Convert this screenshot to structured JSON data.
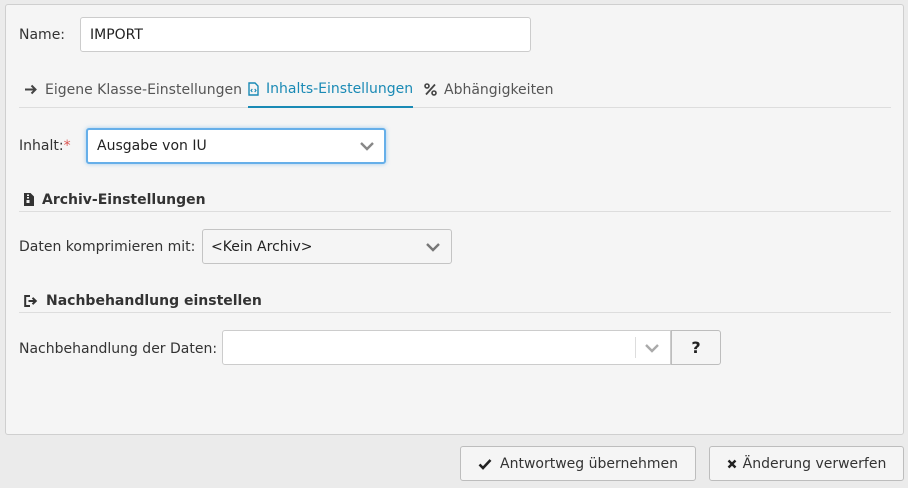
{
  "form": {
    "name_label": "Name:",
    "name_value": "IMPORT"
  },
  "tabs": [
    {
      "label": "Eigene Klasse-Einstellungen",
      "icon": "arrow-right-icon",
      "active": false
    },
    {
      "label": "Inhalts-Einstellungen",
      "icon": "file-code-icon",
      "active": true
    },
    {
      "label": "Abhängigkeiten",
      "icon": "percent-icon",
      "active": false
    }
  ],
  "content": {
    "label": "Inhalt:",
    "required_mark": "*",
    "select_value": "Ausgabe von IU"
  },
  "archive": {
    "heading": "Archiv-Einstellungen",
    "compress_label": "Daten komprimieren mit:",
    "compress_value": "<Kein Archiv>"
  },
  "postprocess": {
    "heading": "Nachbehandlung einstellen",
    "label": "Nachbehandlung der Daten:",
    "value": "",
    "help_label": "?"
  },
  "footer": {
    "accept_label": "Antwortweg übernehmen",
    "discard_label": "Änderung verwerfen"
  },
  "colors": {
    "accent": "#1a8ab5",
    "required": "#d9534f",
    "panel_bg": "#f5f5f5",
    "page_bg": "#ebebeb"
  }
}
